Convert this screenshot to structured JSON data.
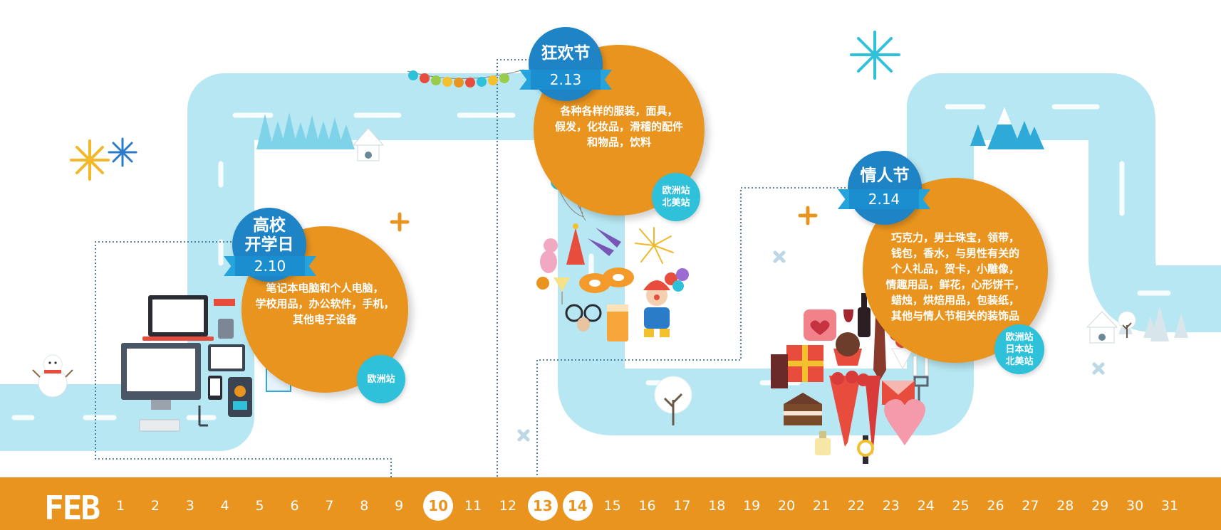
{
  "colors": {
    "road": "#B7E7F2",
    "event_orange": "#E9941F",
    "title_blue": "#1E84C6",
    "ribbon_blue": "#25A3DD",
    "site_cyan": "#2FC0DA",
    "connector": "#2A5E86"
  },
  "timeline": {
    "month": "FEB",
    "days": [
      "1",
      "2",
      "3",
      "4",
      "5",
      "6",
      "7",
      "8",
      "9",
      "10",
      "11",
      "12",
      "13",
      "14",
      "15",
      "16",
      "17",
      "18",
      "19",
      "20",
      "21",
      "22",
      "23",
      "24",
      "25",
      "26",
      "27",
      "28",
      "29",
      "30",
      "31"
    ],
    "highlighted_days": [
      "10",
      "13",
      "14"
    ]
  },
  "events": [
    {
      "title": "高校\n开学日",
      "date": "2.10",
      "description": "笔记本电脑和个人电脑，\n学校用品，办公软件，手机，\n其他电子设备",
      "sites": "欧洲站"
    },
    {
      "title": "狂欢节",
      "date": "2.13",
      "description": "各种各样的服装，面具，\n假发，化妆品，滑稽的配件\n和物品，饮料",
      "sites": "欧洲站\n北美站"
    },
    {
      "title": "情人节",
      "date": "2.14",
      "description": "巧克力，男士珠宝，领带，\n钱包，香水，与男性有关的\n个人礼品，贺卡，小雕像，\n情趣用品，鲜花，心形饼干，\n蜡烛，烘焙用品，包装纸，\n其他与情人节相关的装饰品",
      "sites": "欧洲站\n日本站\n北美站"
    }
  ],
  "decor_icons": [
    "road-icon",
    "snowman-icon",
    "laptop-icon",
    "desktop-computer-icon",
    "tablet-icon",
    "phone-icon",
    "printer-icon",
    "bunting-flags-icon",
    "pine-forest-icon",
    "snow-house-icon",
    "balloons-icon",
    "party-hat-icon",
    "mask-icon",
    "clown-icon",
    "fireworks-icon",
    "gift-box-icon",
    "heart-box-icon",
    "cupcake-icon",
    "roses-icon",
    "watch-icon",
    "cake-icon",
    "wine-bottle-icon",
    "snow-mountain-icon",
    "snowflake-icon",
    "sparkle-icon"
  ]
}
